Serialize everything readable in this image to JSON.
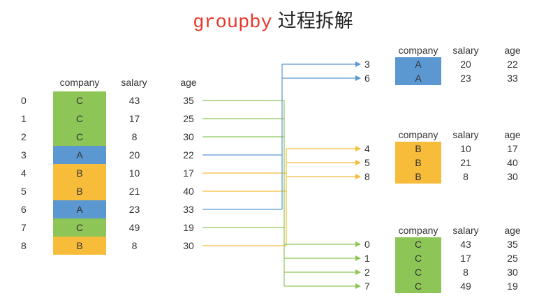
{
  "title": {
    "code": "groupby",
    "text": "过程拆解"
  },
  "headers": {
    "company": "company",
    "salary": "salary",
    "age": "age"
  },
  "colors": {
    "A": "#5b97d1",
    "B": "#f7bc3a",
    "C": "#8dc657",
    "line": "#7f7f7f"
  },
  "source": [
    {
      "index": "0",
      "company": "C",
      "salary": "43",
      "age": "35"
    },
    {
      "index": "1",
      "company": "C",
      "salary": "17",
      "age": "25"
    },
    {
      "index": "2",
      "company": "C",
      "salary": "8",
      "age": "30"
    },
    {
      "index": "3",
      "company": "A",
      "salary": "20",
      "age": "22"
    },
    {
      "index": "4",
      "company": "B",
      "salary": "10",
      "age": "17"
    },
    {
      "index": "5",
      "company": "B",
      "salary": "21",
      "age": "40"
    },
    {
      "index": "6",
      "company": "A",
      "salary": "23",
      "age": "33"
    },
    {
      "index": "7",
      "company": "C",
      "salary": "49",
      "age": "19"
    },
    {
      "index": "8",
      "company": "B",
      "salary": "8",
      "age": "30"
    }
  ],
  "groups": [
    {
      "key": "A",
      "rows": [
        {
          "index": "3",
          "company": "A",
          "salary": "20",
          "age": "22"
        },
        {
          "index": "6",
          "company": "A",
          "salary": "23",
          "age": "33"
        }
      ]
    },
    {
      "key": "B",
      "rows": [
        {
          "index": "4",
          "company": "B",
          "salary": "10",
          "age": "17"
        },
        {
          "index": "5",
          "company": "B",
          "salary": "21",
          "age": "40"
        },
        {
          "index": "8",
          "company": "B",
          "salary": "8",
          "age": "30"
        }
      ]
    },
    {
      "key": "C",
      "rows": [
        {
          "index": "0",
          "company": "C",
          "salary": "43",
          "age": "35"
        },
        {
          "index": "1",
          "company": "C",
          "salary": "17",
          "age": "25"
        },
        {
          "index": "2",
          "company": "C",
          "salary": "8",
          "age": "30"
        },
        {
          "index": "7",
          "company": "C",
          "salary": "49",
          "age": "19"
        }
      ]
    }
  ]
}
